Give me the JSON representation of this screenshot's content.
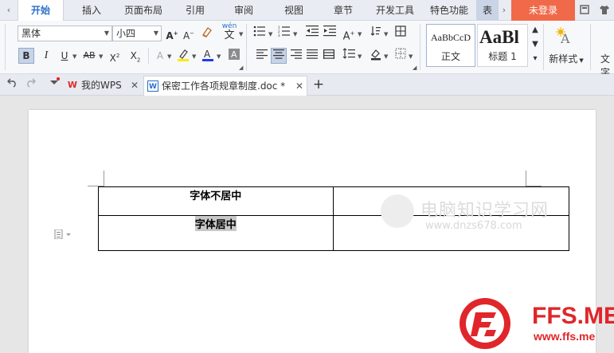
{
  "menubar": {
    "left_arrow": "‹",
    "right_arrow": "›",
    "tabs": [
      "开始",
      "插入",
      "页面布局",
      "引用",
      "审阅",
      "视图",
      "章节",
      "开发工具",
      "特色功能",
      "表"
    ],
    "login": "未登录"
  },
  "ribbon": {
    "font_name": "黑体",
    "font_size": "小四",
    "wen_label": "wén",
    "wen_char": "文",
    "styles": [
      {
        "sample": "AaBbCcD",
        "label": "正文"
      },
      {
        "sample": "AaBl",
        "label": "标题 1"
      }
    ],
    "new_style": "新样式",
    "text_tool": "文字"
  },
  "tabbar": {
    "tabs": [
      {
        "icon": "W",
        "label": "我的WPS"
      },
      {
        "icon": "W",
        "label": "保密工作各项规章制度.doc *"
      }
    ],
    "add": "+"
  },
  "document": {
    "table": [
      [
        "字体不居中",
        ""
      ],
      [
        "字体居中",
        ""
      ]
    ]
  },
  "watermarks": {
    "site_cn": "电脑知识学习网",
    "site_url": "www.dnzs678.com",
    "brand": "FFS.ME",
    "brand_url": "www.ffs.me"
  },
  "colors": {
    "accent_blue": "#2a6fc9",
    "login_bg": "#f06a4a",
    "brand_red": "#e0262a"
  }
}
